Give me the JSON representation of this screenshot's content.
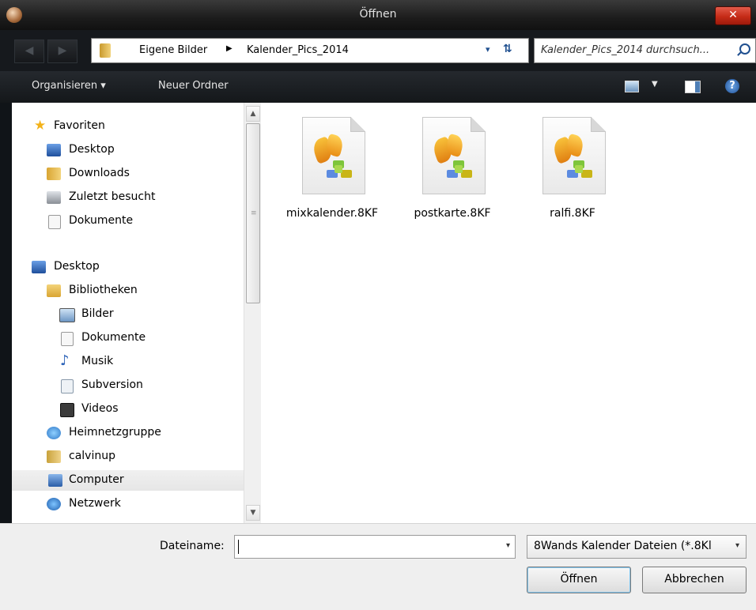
{
  "window": {
    "title": "Öffnen",
    "close_glyph": "✕"
  },
  "address": {
    "back_glyph": "◀",
    "forward_glyph": "▶",
    "crumbs": [
      "Eigene Bilder",
      "Kalender_Pics_2014"
    ],
    "separator_glyph": "▶",
    "dropdown_glyph": "▾",
    "refresh_glyph": "⇅",
    "search_placeholder": "Kalender_Pics_2014 durchsuch..."
  },
  "toolbar": {
    "organize_label": "Organisieren ▾",
    "new_folder_label": "Neuer Ordner",
    "view_dropdown_glyph": "▼",
    "help_glyph": "?"
  },
  "sidebar": {
    "items": [
      {
        "label": "Favoriten",
        "icon": "star-icon",
        "color": "#f3b21a"
      },
      {
        "label": "Desktop",
        "icon": "desktop-icon",
        "color": "#3a6fc2"
      },
      {
        "label": "Downloads",
        "icon": "downloads-folder-icon",
        "color": "#3d7bd8"
      },
      {
        "label": "Zuletzt besucht",
        "icon": "recent-places-icon",
        "color": "#8a8f96"
      },
      {
        "label": "Dokumente",
        "icon": "document-icon",
        "color": "#e7e7e7"
      },
      {
        "label": "Desktop",
        "icon": "desktop-icon",
        "color": "#3a6fc2"
      },
      {
        "label": "Bibliotheken",
        "icon": "libraries-icon",
        "color": "#d9a533"
      },
      {
        "label": "Bilder",
        "icon": "pictures-icon",
        "color": "#6d96c4"
      },
      {
        "label": "Dokumente",
        "icon": "document-icon",
        "color": "#e7e7e7"
      },
      {
        "label": "Musik",
        "icon": "music-note-icon",
        "color": "#2d63b8"
      },
      {
        "label": "Subversion",
        "icon": "subversion-icon",
        "color": "#bfcbd8"
      },
      {
        "label": "Videos",
        "icon": "video-film-icon",
        "color": "#3b3b3b"
      },
      {
        "label": "Heimnetzgruppe",
        "icon": "homegroup-icon",
        "color": "#3f8fd8"
      },
      {
        "label": "calvinup",
        "icon": "user-folder-icon",
        "color": "#c9a23b"
      },
      {
        "label": "Computer",
        "icon": "computer-icon",
        "color": "#3b6db3"
      },
      {
        "label": "Netzwerk",
        "icon": "network-icon",
        "color": "#2b74c8"
      }
    ],
    "scroll_up_glyph": "▲",
    "scroll_down_glyph": "▼",
    "scroll_grip_glyph": "≡"
  },
  "files": [
    {
      "name": "mixkalender.8KF",
      "icon": "8kf-file-icon"
    },
    {
      "name": "postkarte.8KF",
      "icon": "8kf-file-icon"
    },
    {
      "name": "ralfi.8KF",
      "icon": "8kf-file-icon"
    }
  ],
  "bottom": {
    "filename_label": "Dateiname:",
    "filename_value": "",
    "dropdown_glyph": "▾",
    "filter_value": "8Wands Kalender Dateien (*.8Kl",
    "open_label": "Öffnen",
    "cancel_label": "Abbrechen"
  }
}
